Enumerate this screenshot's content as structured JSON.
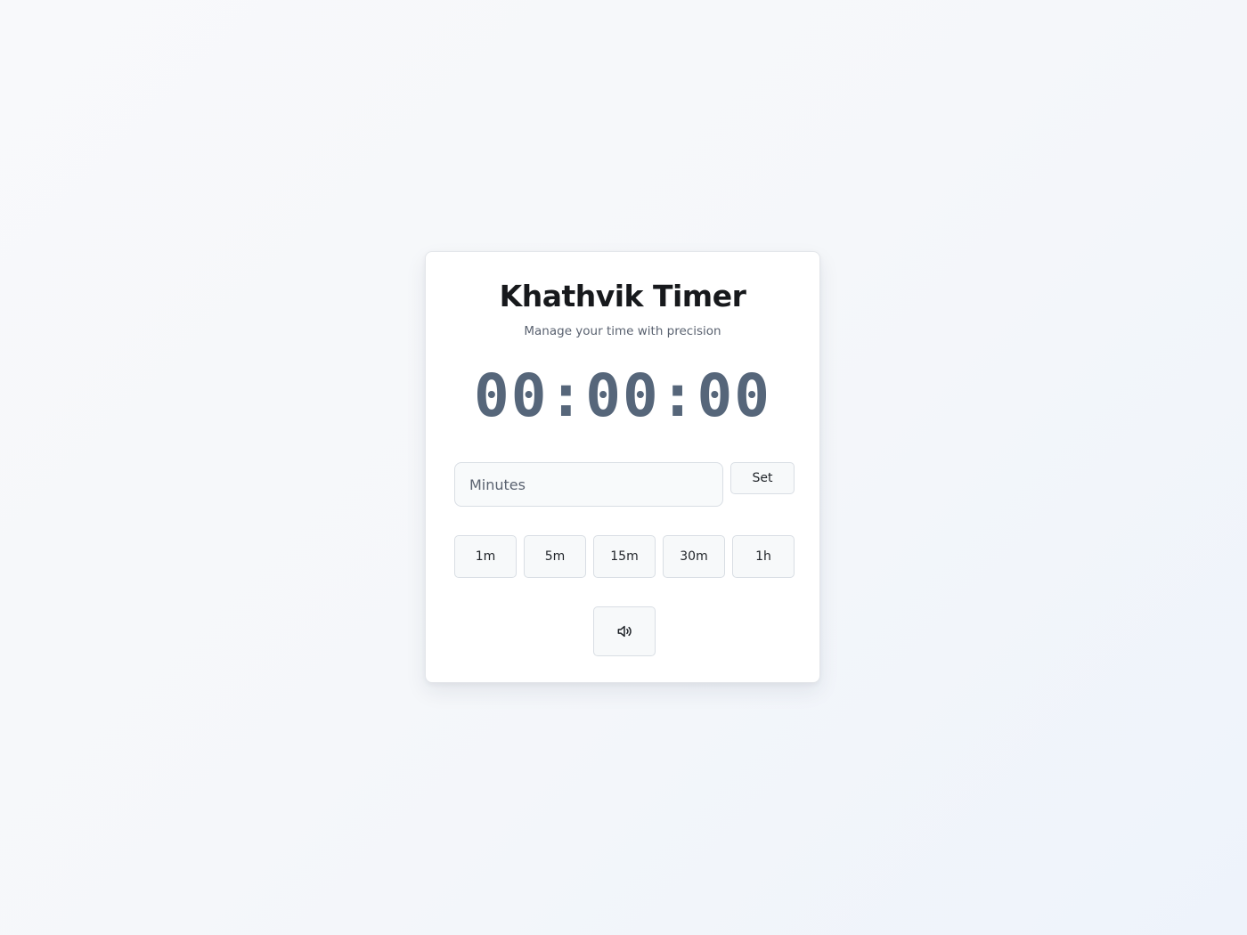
{
  "app": {
    "title": "Khathvik Timer",
    "subtitle": "Manage your time with precision"
  },
  "timer": {
    "display": "00:00:00"
  },
  "input": {
    "placeholder": "Minutes",
    "value": ""
  },
  "actions": {
    "set_label": "Set"
  },
  "presets": [
    {
      "label": "1m"
    },
    {
      "label": "5m"
    },
    {
      "label": "15m"
    },
    {
      "label": "30m"
    },
    {
      "label": "1h"
    }
  ],
  "sound": {
    "icon": "speaker-volume-icon"
  },
  "colors": {
    "clock": "#56667a",
    "title": "#17191c",
    "card_border": "#e3e6ea"
  }
}
